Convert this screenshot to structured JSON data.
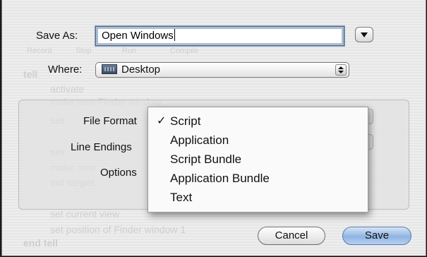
{
  "dialog": {
    "save_as_label": "Save As:",
    "save_as_value": "Open Windows",
    "where_label": "Where:",
    "where_value": "Desktop",
    "file_format_label": "File Format",
    "line_endings_label": "Line Endings",
    "options_label": "Options",
    "cancel_label": "Cancel",
    "save_label": "Save"
  },
  "file_format_menu": {
    "items": [
      {
        "label": "Script",
        "checked": true
      },
      {
        "label": "Application",
        "checked": false
      },
      {
        "label": "Script Bundle",
        "checked": false
      },
      {
        "label": "Application Bundle",
        "checked": false
      },
      {
        "label": "Text",
        "checked": false
      }
    ],
    "check_glyph": "✓"
  },
  "background_script": {
    "toolbar": [
      "Record",
      "Stop",
      "Run",
      "Compile"
    ],
    "lines": [
      "tell",
      "activate",
      "make new Finder window",
      "set",
      "set",
      "make new",
      "set target",
      "set current view",
      "set position of Finder window 1",
      "end tell"
    ]
  },
  "icons": {
    "expand": "disclosure-triangle-icon",
    "folder": "desktop-folder-icon",
    "popup": "popup-stepper-icon"
  },
  "colors": {
    "accent": "#8fb4e3",
    "focus_ring": "#a9bfd9"
  }
}
